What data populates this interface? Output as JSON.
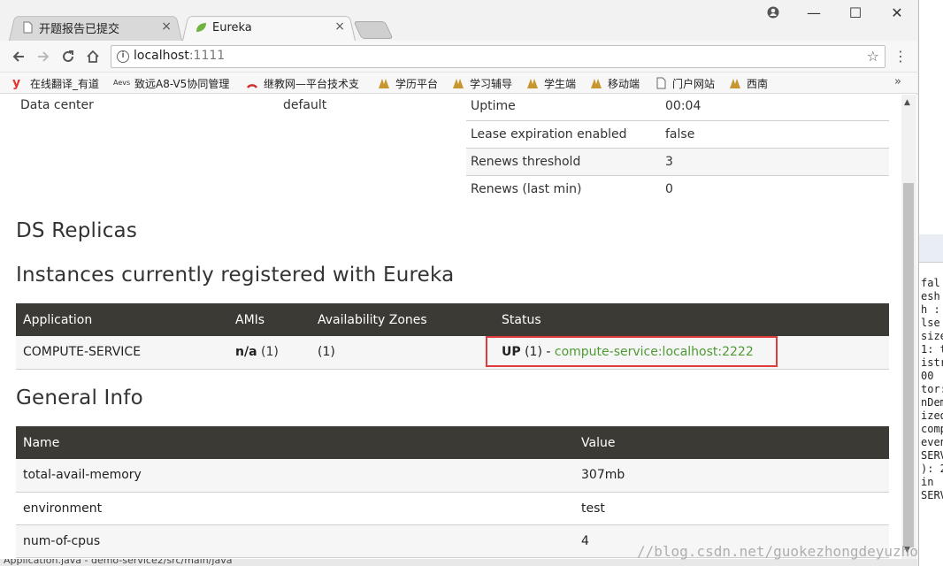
{
  "tabs": [
    {
      "label": "开题报告已提交",
      "icon": "document-icon",
      "close": "×"
    },
    {
      "label": "Eureka",
      "icon": "spring-leaf-icon",
      "close": "×"
    }
  ],
  "window_controls": {
    "minimize": "—",
    "maximize": "☐",
    "close": "✕"
  },
  "address": {
    "host": "localhost",
    "port": ":1111"
  },
  "bookmarks": [
    {
      "label": "在线翻译_有道",
      "icon": "youdao-icon"
    },
    {
      "label": "致远A8-V5协同管理",
      "icon": "seeyon-icon"
    },
    {
      "label": "继教网—平台技术支",
      "icon": "jijiao-icon"
    },
    {
      "label": "学历平台",
      "icon": "bookmark-logo-icon"
    },
    {
      "label": "学习辅导",
      "icon": "bookmark-logo-icon"
    },
    {
      "label": "学生端",
      "icon": "bookmark-logo-icon"
    },
    {
      "label": "移动端",
      "icon": "bookmark-logo-icon"
    },
    {
      "label": "门户网站",
      "icon": "page-icon"
    },
    {
      "label": "西南",
      "icon": "bookmark-logo-icon"
    }
  ],
  "bookmarks_more": "»",
  "environment": {
    "left_label": "Data center",
    "left_value": "default",
    "rows": [
      {
        "name": "Uptime",
        "value": "00:04"
      },
      {
        "name": "Lease expiration enabled",
        "value": "false"
      },
      {
        "name": "Renews threshold",
        "value": "3"
      },
      {
        "name": "Renews (last min)",
        "value": "0"
      }
    ]
  },
  "headings": {
    "replicas": "DS Replicas",
    "instances": "Instances currently registered with Eureka",
    "general": "General Info"
  },
  "instances_table": {
    "headers": [
      "Application",
      "AMIs",
      "Availability Zones",
      "Status"
    ],
    "rows": [
      {
        "application": "COMPUTE-SERVICE",
        "amis_bold": "n/a",
        "amis_count": " (1)",
        "zones": "(1)",
        "status_prefix": "UP",
        "status_count": " (1) - ",
        "status_link": "compute-service:localhost:2222"
      }
    ]
  },
  "general_table": {
    "headers": [
      "Name",
      "Value"
    ],
    "rows": [
      {
        "name": "total-avail-memory",
        "value": "307mb"
      },
      {
        "name": "environment",
        "value": "test"
      },
      {
        "name": "num-of-cpus",
        "value": "4"
      }
    ]
  },
  "watermark": "//blog.csdn.net/guokezhongdeyuzhou",
  "ide_sliver": {
    "lines": [
      "fal",
      "esh",
      "h : ",
      "lse",
      "size",
      "1: t",
      "istr",
      "00",
      "tor:",
      "nDem",
      "ized",
      "comp",
      "even",
      "SERV",
      "): 2",
      " in",
      "SERV"
    ]
  },
  "taskbar_text": "Application.java - demo-service2/src/main/java",
  "colors": {
    "header_bg": "#3c3a34",
    "link": "#4f9a34",
    "highlight": "#e03a3a"
  }
}
